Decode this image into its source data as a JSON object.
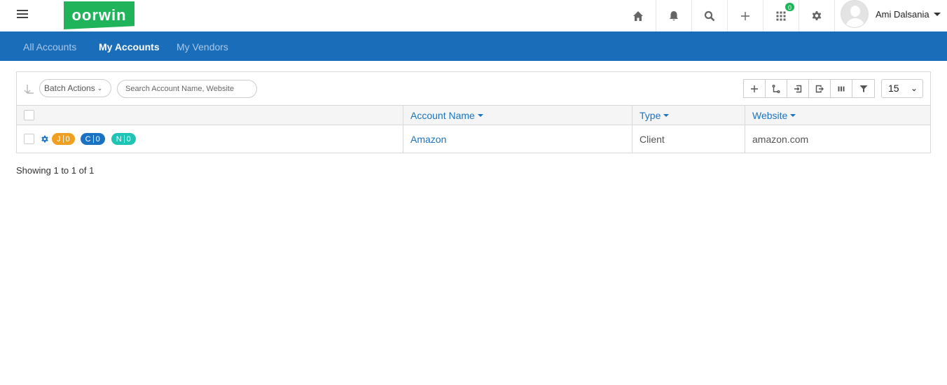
{
  "header": {
    "logo_text": "oorwin",
    "apps_badge": "0",
    "user_name": "Ami Dalsania",
    "icons": [
      "menu-icon",
      "home-icon",
      "bell-icon",
      "search-icon",
      "plus-icon",
      "apps-grid-icon",
      "gear-icon"
    ]
  },
  "nav": {
    "tabs": [
      {
        "label": "All Accounts",
        "active": false
      },
      {
        "label": "My Accounts",
        "active": true
      },
      {
        "label": "My Vendors",
        "active": false
      }
    ]
  },
  "toolbar": {
    "batch_label": "Batch Actions",
    "search_placeholder": "Search Account Name, Website",
    "page_size": "15",
    "tool_icons": [
      "add-icon",
      "merge-icon",
      "import-icon",
      "export-icon",
      "columns-icon",
      "filter-icon"
    ]
  },
  "table": {
    "columns": [
      "Account Name",
      "Type",
      "Website"
    ],
    "rows": [
      {
        "pills": [
          {
            "letter": "J",
            "count": "0"
          },
          {
            "letter": "C",
            "count": "0"
          },
          {
            "letter": "N",
            "count": "0"
          }
        ],
        "account_name": "Amazon",
        "type": "Client",
        "website": "amazon.com"
      }
    ]
  },
  "footer": {
    "showing": "Showing 1 to 1 of 1"
  },
  "colors": {
    "brand_green": "#1fb35a",
    "nav_blue": "#1a6db8",
    "link_blue": "#1a73c2",
    "pill_orange": "#f0a020",
    "pill_teal": "#1fc4b4"
  }
}
